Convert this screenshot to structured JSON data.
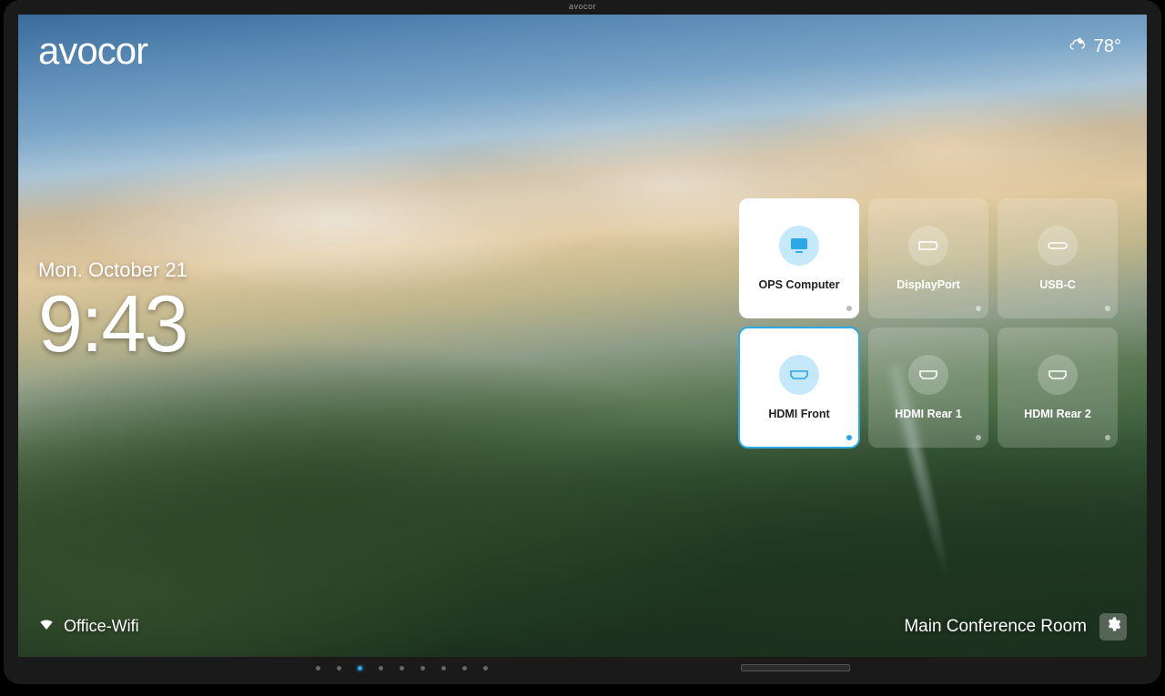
{
  "bezel_brand": "avocor",
  "brand_logo_text": "avocor",
  "weather": {
    "icon": "cloud-night-icon",
    "temperature": "78°"
  },
  "datetime": {
    "date": "Mon. October 21",
    "time": "9:43"
  },
  "sources": [
    {
      "id": "ops",
      "label": "OPS Computer",
      "icon": "monitor-icon",
      "style": "light",
      "selected": false
    },
    {
      "id": "dp",
      "label": "DisplayPort",
      "icon": "displayport-icon",
      "style": "dark",
      "selected": false
    },
    {
      "id": "usbc",
      "label": "USB-C",
      "icon": "usbc-icon",
      "style": "dark",
      "selected": false
    },
    {
      "id": "hdmi-front",
      "label": "HDMI Front",
      "icon": "hdmi-icon",
      "style": "light",
      "selected": true
    },
    {
      "id": "hdmi-rear1",
      "label": "HDMI Rear 1",
      "icon": "hdmi-icon",
      "style": "dark",
      "selected": false
    },
    {
      "id": "hdmi-rear2",
      "label": "HDMI Rear 2",
      "icon": "hdmi-icon",
      "style": "dark",
      "selected": false
    }
  ],
  "wifi": {
    "ssid": "Office-Wifi"
  },
  "room_name": "Main Conference Room"
}
